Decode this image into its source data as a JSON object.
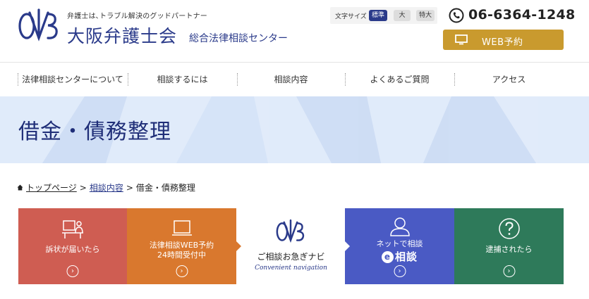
{
  "header": {
    "tagline": "弁護士は､トラブル解決のグッドパートナー",
    "org_name": "大阪弁護士会",
    "org_sub": "総合法律相談センター",
    "phone": "06-6364-1248",
    "web_reserve_label": "WEB予約",
    "font_size": {
      "label": "文字サイズ",
      "standard": "標準",
      "large": "大",
      "extra_large": "特大"
    }
  },
  "nav": {
    "items": [
      "法律相談センターについて",
      "相談するには",
      "相談内容",
      "よくあるご質問",
      "アクセス"
    ]
  },
  "hero": {
    "title": "借金・債務整理"
  },
  "breadcrumb": {
    "home": "トップページ",
    "parent": "相談内容",
    "current": "借金・債務整理",
    "separator": ">"
  },
  "cards": {
    "sued": {
      "label": "訴状が届いたら"
    },
    "web": {
      "line1": "法律相談WEB予約",
      "line2": "24時間受付中"
    },
    "navi": {
      "title": "ご相談お急ぎナビ",
      "subtitle": "Convenient navigation"
    },
    "online": {
      "line1": "ネットで相談",
      "e_mark": "e",
      "line2": "相談"
    },
    "arrest": {
      "label": "逮捕されたら"
    },
    "arrow": "›"
  },
  "colors": {
    "brand_navy": "#2a3a8a",
    "gold": "#c99a2e",
    "hero_bg": "#d6e4f8",
    "card_red": "#cf5d52",
    "card_orange": "#d9782e",
    "card_purple": "#4a5ac4",
    "card_green": "#2e7a5a"
  }
}
